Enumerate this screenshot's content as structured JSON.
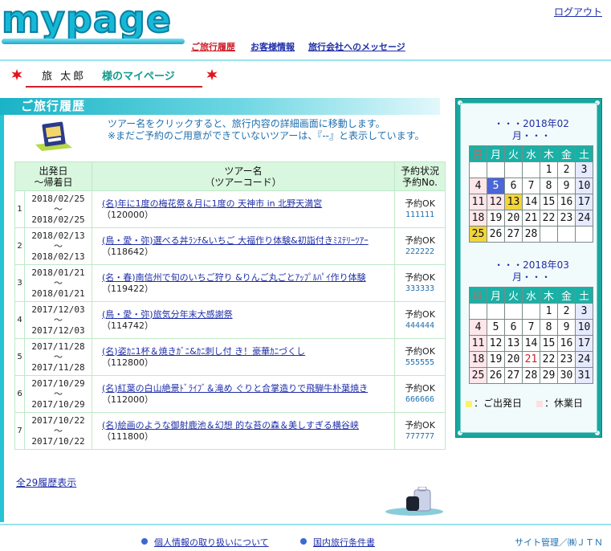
{
  "header": {
    "logo": "mypage",
    "logout": "ログアウト",
    "nav": {
      "history": "ご旅行履歴",
      "customer": "お客様情報",
      "message": "旅行会社へのメッセージ"
    }
  },
  "user": {
    "name": "旅 太郎",
    "suffix": "様のマイページ"
  },
  "section": {
    "title": "ご旅行履歴",
    "intro_line1": "ツアー名をクリックすると、旅行内容の詳細画面に移動します。",
    "intro_line2": "※まだご予約のご用意ができていないツアーは、『--』と表示しています。"
  },
  "table": {
    "headers": {
      "date": "出発日\n〜帰着日",
      "date_line1": "出発日",
      "date_line2": "〜帰着日",
      "tour_line1": "ツアー名",
      "tour_line2": "（ツアーコード）",
      "status_line1": "予約状況",
      "status_line2": "予約No."
    },
    "tilde": "〜",
    "rows": [
      {
        "no": "1",
        "depart": "2018/02/25",
        "return": "2018/02/25",
        "tour": "(名)年に1度の梅花祭＆月に1度の 天神市 in 北野天満宮",
        "code": "（120000）",
        "status": "予約OK",
        "number": "111111"
      },
      {
        "no": "2",
        "depart": "2018/02/13",
        "return": "2018/02/13",
        "tour": "(鳥・愛・弥)選べる丼ﾗﾝﾁ&いちご 大福作り体験&初詣付きﾐｽﾃﾘｰﾂｱｰ",
        "code": "（118642）",
        "status": "予約OK",
        "number": "222222"
      },
      {
        "no": "3",
        "depart": "2018/01/21",
        "return": "2018/01/21",
        "tour": "(名・春)南信州で旬のいちご狩り &りんご丸ごとｱｯﾌﾟﾙﾊﾟｲ作り体験",
        "code": "（119422）",
        "status": "予約OK",
        "number": "333333"
      },
      {
        "no": "4",
        "depart": "2017/12/03",
        "return": "2017/12/03",
        "tour": "(鳥・愛・弥)旅気分年末大感謝祭",
        "code": "（114742）",
        "status": "予約OK",
        "number": "444444"
      },
      {
        "no": "5",
        "depart": "2017/11/28",
        "return": "2017/11/28",
        "tour": "(名)姿ｶﾆ1杯＆焼きｶﾞﾆ&ｶﾆ刺し付 き！豪華ｶﾆづくし",
        "code": "（112800）",
        "status": "予約OK",
        "number": "555555"
      },
      {
        "no": "6",
        "depart": "2017/10/29",
        "return": "2017/10/29",
        "tour": "(名)紅葉の白山絶景ﾄﾞﾗｲﾌﾞ＆滝め ぐりと合掌造りで飛騨牛朴葉焼き",
        "code": "（112000）",
        "status": "予約OK",
        "number": "666666"
      },
      {
        "no": "7",
        "depart": "2017/10/22",
        "return": "2017/10/22",
        "tour": "(名)絵画のような御射鹿池＆幻想 的な苔の森＆美しすぎる横谷峡",
        "code": "（111800）",
        "status": "予約OK",
        "number": "777777"
      }
    ]
  },
  "all_history_link": "全29履歴表示",
  "calendar": {
    "weekdays": [
      "日",
      "月",
      "火",
      "水",
      "木",
      "金",
      "土"
    ],
    "months": [
      {
        "title_line1": "・・・2018年02",
        "title_line2": "月・・・",
        "weeks": [
          [
            "",
            "",
            "",
            "",
            "1",
            "2",
            "3"
          ],
          [
            "4",
            "5",
            "6",
            "7",
            "8",
            "9",
            "10"
          ],
          [
            "11",
            "12",
            "13",
            "14",
            "15",
            "16",
            "17"
          ],
          [
            "18",
            "19",
            "20",
            "21",
            "22",
            "23",
            "24"
          ],
          [
            "25",
            "26",
            "27",
            "28",
            "",
            "",
            ""
          ]
        ]
      },
      {
        "title_line1": "・・・2018年03",
        "title_line2": "月・・・",
        "weeks": [
          [
            "",
            "",
            "",
            "",
            "1",
            "2",
            "3"
          ],
          [
            "4",
            "5",
            "6",
            "7",
            "8",
            "9",
            "10"
          ],
          [
            "11",
            "12",
            "13",
            "14",
            "15",
            "16",
            "17"
          ],
          [
            "18",
            "19",
            "20",
            "21",
            "22",
            "23",
            "24"
          ],
          [
            "25",
            "26",
            "27",
            "28",
            "29",
            "30",
            "31"
          ]
        ]
      }
    ],
    "legend": {
      "departure": "：ご出発日",
      "holiday": "：休業日",
      "departure_color": "#fff06a",
      "holiday_color": "#ffdfe4"
    }
  },
  "footer": {
    "privacy": "個人情報の取り扱いについて",
    "terms": "国内旅行条件書",
    "admin": "サイト管理／㈱ＪＴＮ"
  }
}
